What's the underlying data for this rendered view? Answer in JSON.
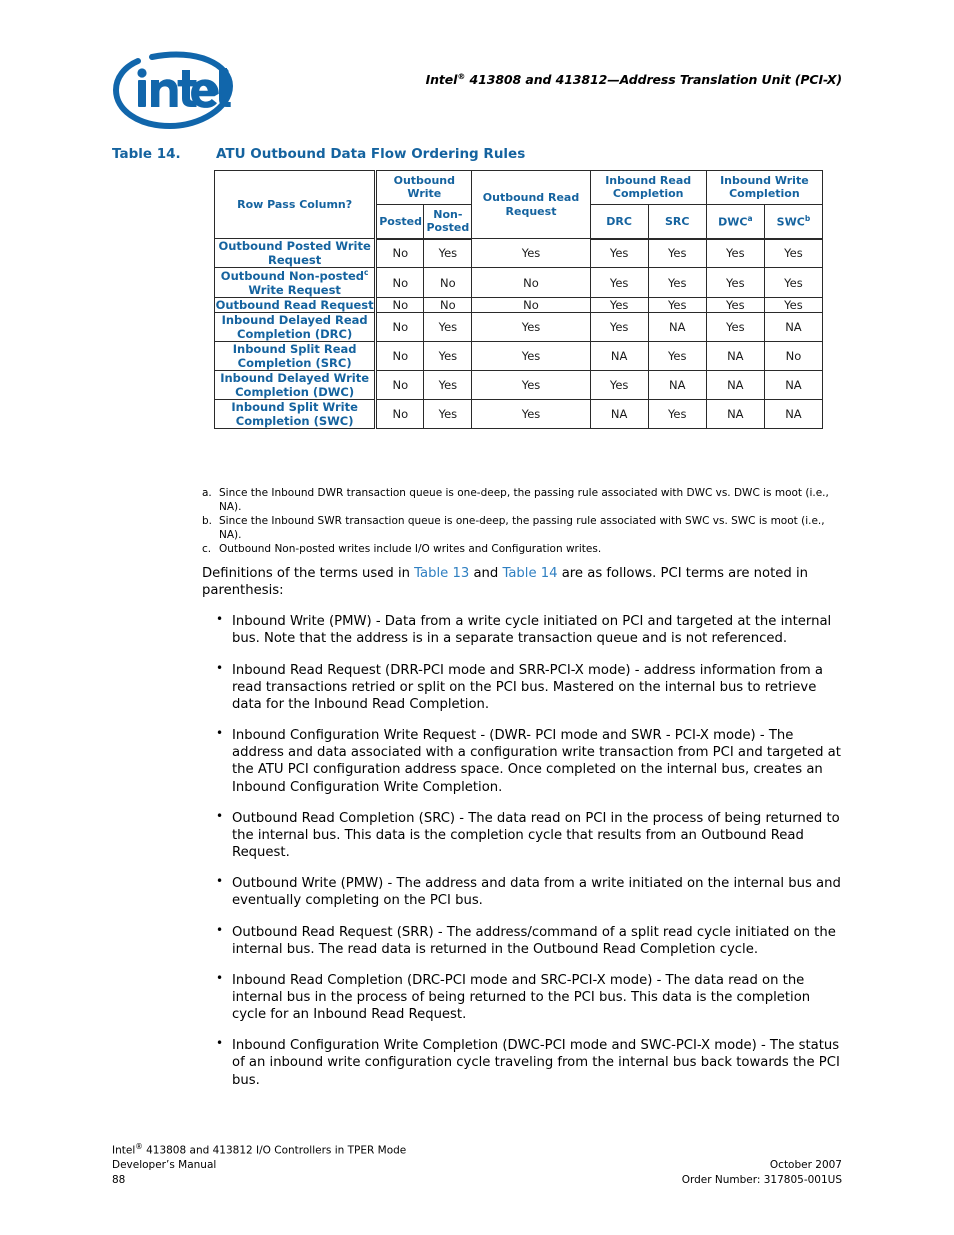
{
  "header": {
    "logo_alt": "intel",
    "logo_wordmark": "intel",
    "logo_color": "#1166ab",
    "running_title_pre": "Intel",
    "running_title_sup": "®",
    "running_title_post": " 413808 and 413812—Address Translation Unit (PCI-X)"
  },
  "caption": {
    "number": "Table 14.",
    "title": "ATU Outbound Data Flow Ordering Rules"
  },
  "accent_color": "#15639f",
  "table": {
    "row_label_header": "Row Pass Column?",
    "group_headers": [
      {
        "label": "Outbound Write",
        "span": 2
      },
      {
        "label": "Outbound Read Request",
        "span": 1
      },
      {
        "label": "Inbound Read Completion",
        "span": 2
      },
      {
        "label": "Inbound Write Completion",
        "span": 2
      }
    ],
    "sub_headers": [
      {
        "label": "Posted",
        "sup": ""
      },
      {
        "label": "Non-Posted",
        "sup": ""
      },
      {
        "label": "DRC",
        "sup": ""
      },
      {
        "label": "SRC",
        "sup": ""
      },
      {
        "label": "DWC",
        "sup": "a"
      },
      {
        "label": "SWC",
        "sup": "b"
      }
    ],
    "rows": [
      {
        "label": "Outbound Posted Write Request",
        "sup": "",
        "values": [
          "No",
          "Yes",
          "Yes",
          "Yes",
          "Yes",
          "Yes",
          "Yes"
        ]
      },
      {
        "label": "Outbound Non-posted",
        "sup": "c",
        "label_tail": "Write Request",
        "values": [
          "No",
          "No",
          "No",
          "Yes",
          "Yes",
          "Yes",
          "Yes"
        ]
      },
      {
        "label": "Outbound Read Request",
        "sup": "",
        "values": [
          "No",
          "No",
          "No",
          "Yes",
          "Yes",
          "Yes",
          "Yes"
        ]
      },
      {
        "label": "Inbound Delayed Read Completion (DRC)",
        "sup": "",
        "values": [
          "No",
          "Yes",
          "Yes",
          "Yes",
          "NA",
          "Yes",
          "NA"
        ]
      },
      {
        "label": "Inbound Split Read Completion (SRC)",
        "sup": "",
        "values": [
          "No",
          "Yes",
          "Yes",
          "NA",
          "Yes",
          "NA",
          "No"
        ]
      },
      {
        "label": "Inbound Delayed Write Completion (DWC)",
        "sup": "",
        "values": [
          "No",
          "Yes",
          "Yes",
          "Yes",
          "NA",
          "NA",
          "NA"
        ]
      },
      {
        "label": "Inbound Split Write Completion (SWC)",
        "sup": "",
        "values": [
          "No",
          "Yes",
          "Yes",
          "NA",
          "Yes",
          "NA",
          "NA"
        ]
      }
    ]
  },
  "footnotes": [
    {
      "mark": "a.",
      "text": "Since the Inbound DWR transaction queue is one-deep, the passing rule associated with DWC vs. DWC is moot (i.e., NA)."
    },
    {
      "mark": "b.",
      "text": "Since the Inbound SWR transaction queue is one-deep, the passing rule associated with SWC vs. SWC is moot (i.e., NA)."
    },
    {
      "mark": "c.",
      "text": "Outbound Non-posted writes include I/O writes and Configuration writes."
    }
  ],
  "intro": {
    "part1": "Definitions of the terms used in ",
    "xref1": "Table 13",
    "part2": " and ",
    "xref2": "Table 14",
    "part3": " are as follows. PCI terms are noted in parenthesis:"
  },
  "definitions": [
    "Inbound Write (PMW) - Data from a write cycle initiated on PCI and targeted at the internal bus. Note that the address is in a separate transaction queue and is not referenced.",
    "Inbound Read Request (DRR-PCI mode and SRR-PCI-X mode) - address information from a read transactions retried or split on the PCI bus. Mastered on the internal bus to retrieve data for the Inbound Read Completion.",
    "Inbound Configuration Write Request - (DWR- PCI mode and SWR - PCI-X mode) - The address and data associated with a configuration write transaction from PCI and targeted at the ATU PCI configuration address space. Once completed on the internal bus, creates an Inbound Configuration Write Completion.",
    "Outbound Read Completion (SRC) - The data read on PCI in the process of being returned to the internal bus. This data is the completion cycle that results from an Outbound Read Request.",
    "Outbound Write (PMW) - The address and data from a write initiated on the internal bus and eventually completing on the PCI bus.",
    "Outbound Read Request (SRR) - The address/command of a split read cycle initiated on the internal bus. The read data is returned in the Outbound Read Completion cycle.",
    "Inbound Read Completion (DRC-PCI mode and SRC-PCI-X mode) - The data read on the internal bus in the process of being returned to the PCI bus. This data is the completion cycle for an Inbound Read Request.",
    "Inbound Configuration Write Completion (DWC-PCI mode and SWC-PCI-X mode) - The status of an inbound write configuration cycle traveling from the internal bus back towards the PCI bus."
  ],
  "footer": {
    "left_line1_pre": "Intel",
    "left_line1_sup": "®",
    "left_line1_post": " 413808 and 413812 I/O Controllers in TPER Mode",
    "left_line2": "Developer’s Manual",
    "page_number": "88",
    "right_line1": "October 2007",
    "right_line2": "Order Number: 317805-001US"
  }
}
